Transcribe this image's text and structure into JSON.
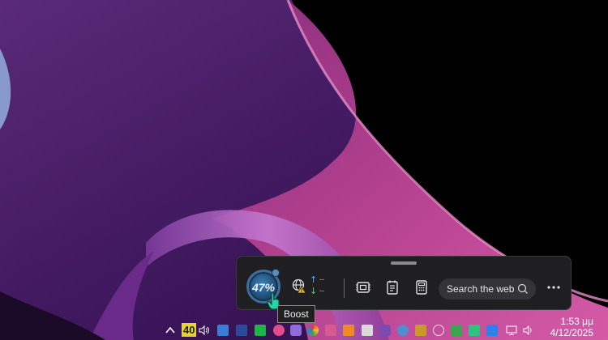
{
  "widget_bar": {
    "boost_percent": "47%",
    "tooltip": "Boost",
    "network": {
      "upload": "--",
      "download": "--"
    },
    "search_label": "Search the web",
    "icons": [
      "boost-dial",
      "network-globe-icon",
      "ram-chip-icon",
      "notes-icon",
      "calculator-icon",
      "search-icon",
      "more-icon"
    ]
  },
  "taskbar": {
    "tray_badge": "40",
    "clock": {
      "time": "1:53 μμ",
      "date": "4/12/2025"
    }
  },
  "colors": {
    "accent": "#3f7fb0",
    "wallpaper_magenta": "#c0489a",
    "wallpaper_purple": "#4a1c63"
  }
}
